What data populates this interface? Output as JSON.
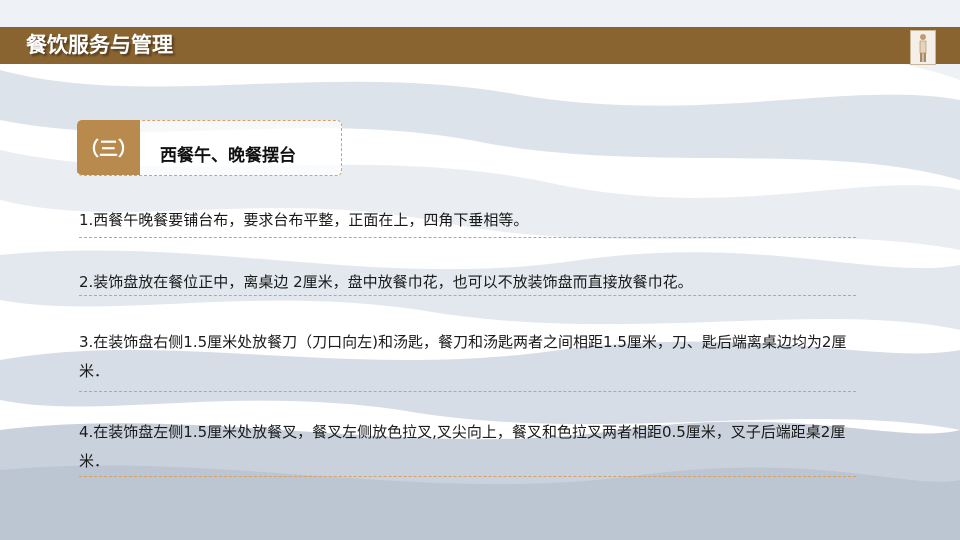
{
  "header": {
    "title": "餐饮服务与管理",
    "accent_color": "#8a6430"
  },
  "section": {
    "number": "（三）",
    "title": "西餐午、晚餐摆台",
    "badge_color": "#b98a4d"
  },
  "items": [
    "1.西餐午晚餐要铺台布，要求台布平整，正面在上，四角下垂相等。",
    "2.装饰盘放在餐位正中，离桌边 2厘米，盘中放餐巾花，也可以不放装饰盘而直接放餐巾花。",
    "3.在装饰盘右侧1.5厘米处放餐刀（刀口向左)和汤匙，餐刀和汤匙两者之间相距1.5厘米，刀、匙后端离桌边均为2厘米．",
    "4.在装饰盘左侧1.5厘米处放餐叉，餐叉左侧放色拉叉,叉尖向上，餐叉和色拉叉两者相距0.5厘米，叉子后端距桌2厘米．"
  ]
}
